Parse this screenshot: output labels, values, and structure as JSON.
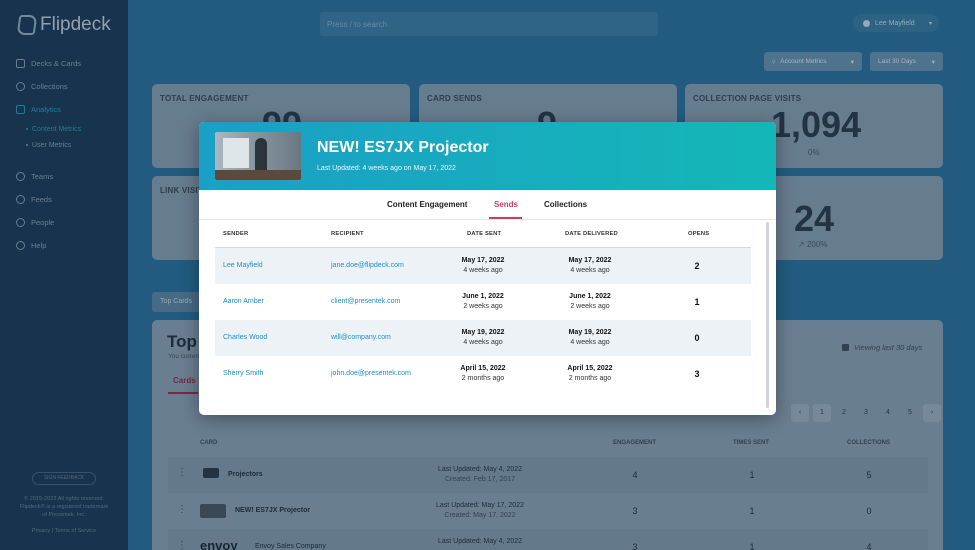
{
  "app": {
    "name": "Flipdeck"
  },
  "sidebar": {
    "items": [
      {
        "label": "Decks & Cards"
      },
      {
        "label": "Collections"
      },
      {
        "label": "Analytics"
      },
      {
        "label": "Teams"
      },
      {
        "label": "Feeds"
      },
      {
        "label": "People"
      },
      {
        "label": "Help"
      }
    ],
    "analytics_sub": [
      {
        "label": "Content Metrics"
      },
      {
        "label": "User Metrics"
      }
    ],
    "footer_button": "SIGN FEEDBACK",
    "copyright": "© 2015-2022 All rights reserved.",
    "trademark": "Flipdeck® is a registered trademark",
    "trademark2": "of Presentek, Inc.",
    "links": "Privacy | Terms of Service"
  },
  "header": {
    "search_placeholder": "Press / to search",
    "user_name": "Lee Mayfield",
    "filter_metric": "Account Metrics",
    "filter_range": "Last 30 Days"
  },
  "stats": {
    "total_engagement": {
      "label": "TOTAL ENGAGEMENT",
      "value": "99"
    },
    "card_sends": {
      "label": "CARD SENDS",
      "value": "9"
    },
    "collection_visits": {
      "label": "COLLECTION PAGE VISITS",
      "value": "1,094",
      "delta": "0%"
    },
    "link_visits": {
      "label": "LINK VISITS"
    },
    "fourth": {
      "value": "24",
      "delta": "200%"
    }
  },
  "section": {
    "tab": "Top Cards",
    "title": "Top Cards",
    "subtitle": "You currently",
    "cards_tab": "Cards",
    "viewing": "Viewing last 30 days",
    "pages": [
      "1",
      "2",
      "3",
      "4",
      "5"
    ],
    "columns": {
      "card": "CARD",
      "engagement": "ENGAGEMENT",
      "times_sent": "TIMES SENT",
      "collections": "COLLECTIONS"
    },
    "rows": [
      {
        "name": "Projectors",
        "updated": "Last Updated: May 4, 2022",
        "created": "Created: Feb 17, 2017",
        "engagement": "4",
        "sent": "1",
        "collections": "5"
      },
      {
        "name": "NEW! ES7JX Projector",
        "updated": "Last Updated: May 17, 2022",
        "created": "Created: May 17, 2022",
        "engagement": "3",
        "sent": "1",
        "collections": "0"
      },
      {
        "name": "Envoy Sales Company",
        "brand": "envoy",
        "updated": "Last Updated: May 4, 2022",
        "created": "",
        "engagement": "3",
        "sent": "1",
        "collections": "4"
      }
    ]
  },
  "modal": {
    "title": "NEW! ES7JX Projector",
    "updated": "Last Updated: 4 weeks ago on May 17, 2022",
    "tabs": [
      "Content Engagement",
      "Sends",
      "Collections"
    ],
    "columns": {
      "sender": "SENDER",
      "recipient": "RECIPIENT",
      "date_sent": "DATE SENT",
      "date_delivered": "DATE DELIVERED",
      "opens": "OPENS"
    },
    "rows": [
      {
        "sender": "Lee Mayfield",
        "recipient": "jane.doe@flipdeck.com",
        "sent": "May 17, 2022",
        "sent_rel": "4 weeks ago",
        "delivered": "May 17, 2022",
        "delivered_rel": "4 weeks ago",
        "opens": "2"
      },
      {
        "sender": "Aaron Amber",
        "recipient": "client@presentek.com",
        "sent": "June 1, 2022",
        "sent_rel": "2 weeks ago",
        "delivered": "June 1, 2022",
        "delivered_rel": "2 weeks ago",
        "opens": "1"
      },
      {
        "sender": "Charles Wood",
        "recipient": "will@company.com",
        "sent": "May 19, 2022",
        "sent_rel": "4 weeks ago",
        "delivered": "May 19, 2022",
        "delivered_rel": "4 weeks ago",
        "opens": "0"
      },
      {
        "sender": "Sherry Smith",
        "recipient": "john.doe@presentek.com",
        "sent": "April 15, 2022",
        "sent_rel": "2 months ago",
        "delivered": "April 15, 2022",
        "delivered_rel": "2 months ago",
        "opens": "3"
      }
    ]
  }
}
